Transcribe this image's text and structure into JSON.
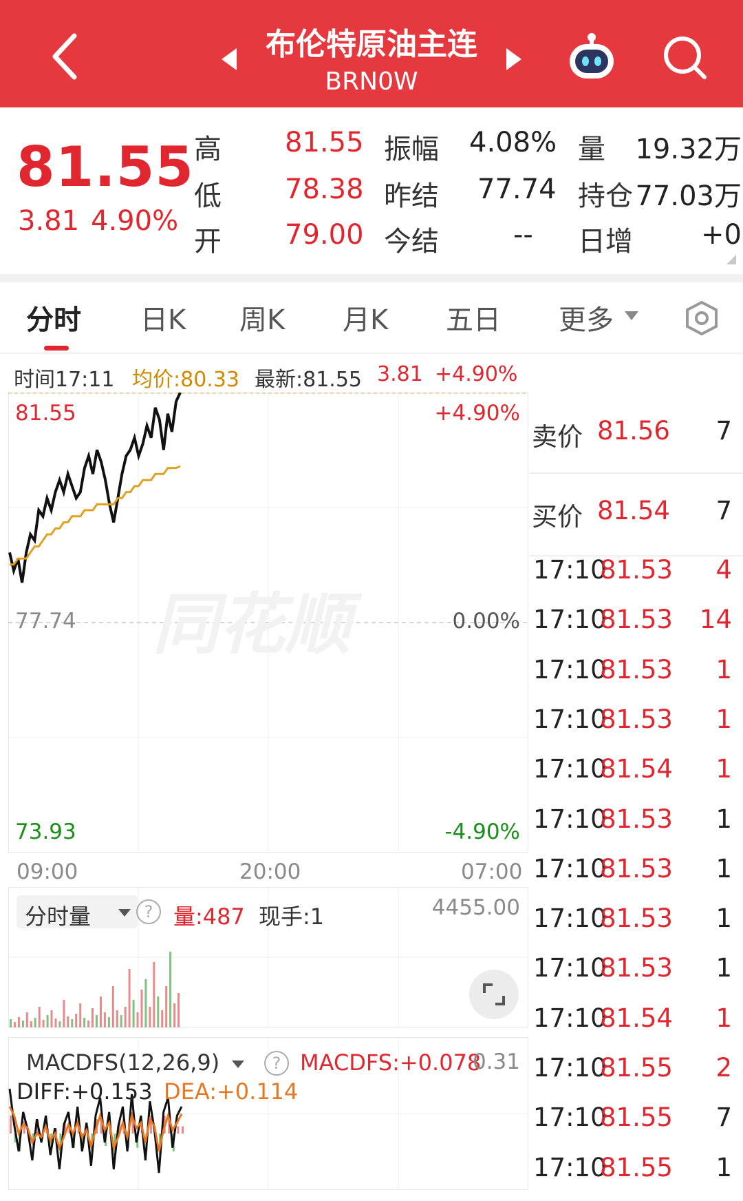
{
  "header": {
    "title": "布伦特原油主连",
    "code": "BRN0W"
  },
  "quote": {
    "price": "81.55",
    "change": "3.81",
    "change_pct": "4.90%",
    "stats": [
      {
        "label": "高",
        "value": "81.55"
      },
      {
        "label": "振幅",
        "value": "4.08%"
      },
      {
        "label": "量",
        "value": "19.32万"
      },
      {
        "label": "低",
        "value": "78.38"
      },
      {
        "label": "昨结",
        "value": "77.74"
      },
      {
        "label": "持仓",
        "value": "77.03万"
      },
      {
        "label": "开",
        "value": "79.00"
      },
      {
        "label": "今结",
        "value": "--"
      },
      {
        "label": "日增",
        "value": "+0"
      }
    ]
  },
  "tabs": {
    "items": [
      "分时",
      "日K",
      "周K",
      "月K",
      "五日",
      "更多"
    ],
    "active": "分时"
  },
  "info_bar": {
    "time": "时间17:11",
    "avg": "均价:80.33",
    "latest": "最新:81.55",
    "change": "3.81",
    "change_pct": "+4.90%"
  },
  "chart_data": {
    "type": "line",
    "price_axis": {
      "top": "81.55",
      "mid": "77.74",
      "bottom": "73.93"
    },
    "pct_axis": {
      "top": "+4.90%",
      "mid": "0.00%",
      "bottom": "-4.90%"
    },
    "x_ticks": [
      "09:00",
      "20:00",
      "07:00"
    ],
    "ylim": [
      73.93,
      81.55
    ],
    "series": [
      {
        "name": "price",
        "color": "#111111",
        "values": [
          78.9,
          78.6,
          78.8,
          78.4,
          78.9,
          79.2,
          79.1,
          79.6,
          79.5,
          79.8,
          79.6,
          79.9,
          80.1,
          79.9,
          80.2,
          80.0,
          79.8,
          79.9,
          80.3,
          80.5,
          80.2,
          80.6,
          80.4,
          80.1,
          79.7,
          79.4,
          79.8,
          80.2,
          80.5,
          80.6,
          80.8,
          80.5,
          80.7,
          81.0,
          80.8,
          81.3,
          81.1,
          80.6,
          81.2,
          80.9,
          81.4,
          81.55
        ]
      },
      {
        "name": "avg",
        "color": "#e0a020",
        "values": [
          78.7,
          78.7,
          78.8,
          78.8,
          78.8,
          78.9,
          79.0,
          79.0,
          79.1,
          79.2,
          79.2,
          79.3,
          79.3,
          79.4,
          79.4,
          79.5,
          79.5,
          79.5,
          79.6,
          79.6,
          79.6,
          79.7,
          79.7,
          79.7,
          79.7,
          79.7,
          79.8,
          79.8,
          79.9,
          79.9,
          80.0,
          80.0,
          80.1,
          80.1,
          80.1,
          80.2,
          80.2,
          80.2,
          80.3,
          80.3,
          80.3,
          80.33
        ]
      }
    ]
  },
  "volume_panel": {
    "selector": "分时量",
    "vol": "量:487",
    "hand": "现手:1",
    "max": "4455.00",
    "bars": [
      12,
      8,
      15,
      10,
      22,
      9,
      14,
      30,
      11,
      18,
      25,
      13,
      9,
      40,
      16,
      12,
      20,
      35,
      14,
      10,
      28,
      18,
      45,
      22,
      15,
      60,
      25,
      18,
      30,
      85,
      40,
      22,
      55,
      70,
      30,
      95,
      45,
      25,
      60,
      110,
      35,
      50
    ]
  },
  "macd_panel": {
    "selector": "MACDFS(12,26,9)",
    "macd": "MACDFS:+0.078",
    "diff": "DIFF:+0.153",
    "dea": "DEA:+0.114",
    "max": "0.31",
    "diff_values": [
      0.25,
      0.05,
      -0.1,
      0.12,
      0.02,
      -0.15,
      0.08,
      -0.05,
      0.1,
      -0.12,
      0.03,
      -0.2,
      0.05,
      0.12,
      -0.08,
      0.15,
      -0.1,
      0.06,
      -0.18,
      0.1,
      0.2,
      -0.05,
      0.12,
      -0.2,
      0.04,
      0.15,
      -0.1,
      0.22,
      -0.05,
      0.1,
      -0.15,
      0.18,
      0.02,
      -0.22,
      0.12,
      0.2,
      -0.08,
      0.1,
      0.15
    ],
    "dea_values": [
      0.15,
      0.1,
      0.0,
      0.05,
      0.03,
      -0.05,
      0.0,
      -0.02,
      0.04,
      -0.04,
      0.0,
      -0.08,
      -0.02,
      0.05,
      0.0,
      0.06,
      -0.02,
      0.02,
      -0.07,
      0.02,
      0.1,
      0.02,
      0.06,
      -0.08,
      -0.02,
      0.06,
      -0.02,
      0.1,
      0.03,
      0.06,
      -0.05,
      0.08,
      0.04,
      -0.1,
      0.02,
      0.1,
      0.02,
      0.06,
      0.11
    ]
  },
  "order_book": {
    "ask": {
      "label": "卖价",
      "price": "81.56",
      "vol": "7"
    },
    "bid": {
      "label": "买价",
      "price": "81.54",
      "vol": "7"
    }
  },
  "trades": [
    {
      "time": "17:10",
      "price": "81.53",
      "vol": "4",
      "color": "red"
    },
    {
      "time": "17:10",
      "price": "81.53",
      "vol": "14",
      "color": "red"
    },
    {
      "time": "17:10",
      "price": "81.53",
      "vol": "1",
      "color": "red"
    },
    {
      "time": "17:10",
      "price": "81.53",
      "vol": "1",
      "color": "red"
    },
    {
      "time": "17:10",
      "price": "81.54",
      "vol": "1",
      "color": "red"
    },
    {
      "time": "17:10",
      "price": "81.53",
      "vol": "1",
      "color": "dark"
    },
    {
      "time": "17:10",
      "price": "81.53",
      "vol": "1",
      "color": "dark"
    },
    {
      "time": "17:10",
      "price": "81.53",
      "vol": "1",
      "color": "dark"
    },
    {
      "time": "17:10",
      "price": "81.53",
      "vol": "1",
      "color": "dark"
    },
    {
      "time": "17:10",
      "price": "81.54",
      "vol": "1",
      "color": "red"
    },
    {
      "time": "17:10",
      "price": "81.55",
      "vol": "2",
      "color": "red"
    },
    {
      "time": "17:10",
      "price": "81.55",
      "vol": "7",
      "color": "dark"
    },
    {
      "time": "17:10",
      "price": "81.55",
      "vol": "1",
      "color": "dark"
    }
  ],
  "colors": {
    "brand": "#e5393f",
    "up": "#e0262e",
    "down": "#1b8f1b",
    "avg": "#d08a00"
  }
}
